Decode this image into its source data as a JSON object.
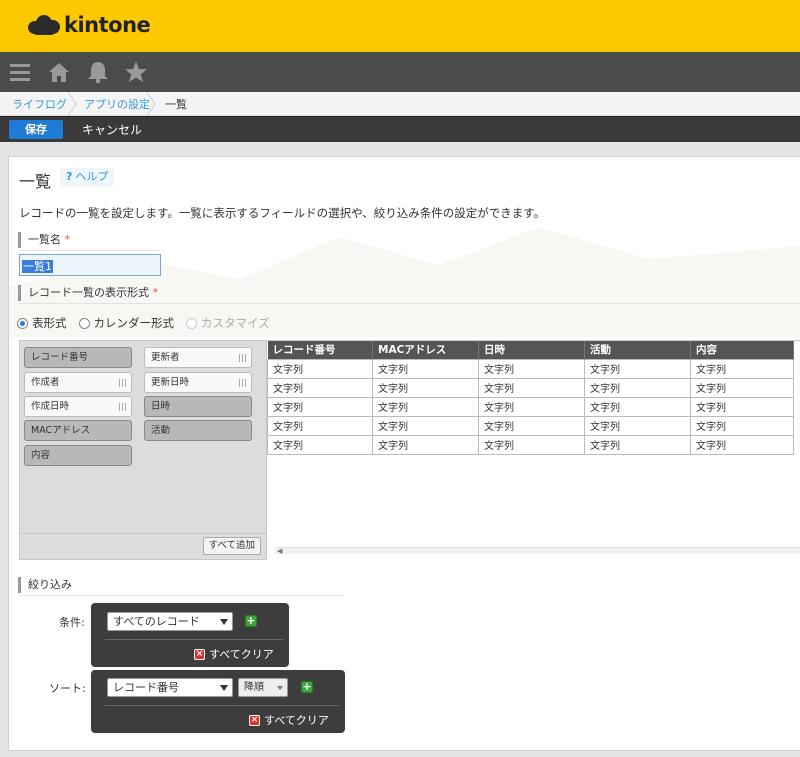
{
  "app": {
    "logo_text": "kintone"
  },
  "breadcrumb": {
    "item1": "ライフログ",
    "item2": "アプリの設定",
    "current": "一覧"
  },
  "actions": {
    "save": "保存",
    "cancel": "キャンセル"
  },
  "page": {
    "title": "一覧",
    "help": "ヘルプ",
    "help_glyph": "?",
    "description": "レコードの一覧を設定します。一覧に表示するフィールドの選択や、絞り込み条件の設定ができます。"
  },
  "view_name": {
    "label": "一覧名",
    "required_mark": "*",
    "value": "一覧1"
  },
  "display_format": {
    "label": "レコード一覧の表示形式",
    "required_mark": "*",
    "options": [
      "表形式",
      "カレンダー形式",
      "カスタマイズ"
    ],
    "selected": "表形式"
  },
  "fields": {
    "left": [
      "レコード番号",
      "作成者",
      "作成日時",
      "MACアドレス",
      "内容"
    ],
    "right": [
      "更新者",
      "更新日時",
      "日時",
      "活動"
    ],
    "add_all": "すべて追加"
  },
  "preview": {
    "columns": [
      "レコード番号",
      "MACアドレス",
      "日時",
      "活動",
      "内容"
    ],
    "rows": [
      [
        "文字列",
        "文字列",
        "文字列",
        "文字列",
        "文字列"
      ],
      [
        "文字列",
        "文字列",
        "文字列",
        "文字列",
        "文字列"
      ],
      [
        "文字列",
        "文字列",
        "文字列",
        "文字列",
        "文字列"
      ],
      [
        "文字列",
        "文字列",
        "文字列",
        "文字列",
        "文字列"
      ],
      [
        "文字列",
        "文字列",
        "文字列",
        "文字列",
        "文字列"
      ]
    ]
  },
  "filter": {
    "label": "絞り込み",
    "condition_label": "条件:",
    "condition_value": "すべてのレコード",
    "clear_all": "すべてクリア",
    "sort_label": "ソート:",
    "sort_field": "レコード番号",
    "sort_order": "降順",
    "sort_clear_all": "すべてクリア"
  },
  "colors": {
    "header": "#fcc800",
    "nav": "#4b4b4b",
    "save": "#1e7bd6",
    "link": "#3498db"
  }
}
